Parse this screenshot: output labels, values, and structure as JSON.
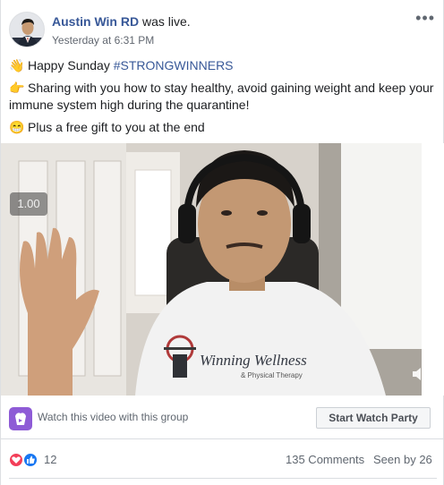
{
  "post": {
    "author": "Austin Win RD",
    "activity": "was live.",
    "timestamp": "Yesterday at 6:31 PM",
    "menu_icon": "more-dots-icon",
    "lines": [
      {
        "emoji": "👋",
        "text_before": "Happy Sunday ",
        "hashtag": "#STRONGWINNERS"
      },
      {
        "emoji": "👉",
        "text": "Sharing with you how to stay healthy, avoid gaining weight and keep your immune system high during the quarantine!"
      },
      {
        "emoji": "😁",
        "text": "Plus a free gift to you at the end"
      }
    ]
  },
  "video": {
    "speed_label": "1.00",
    "shirt_brand": "Winning Wellness",
    "shirt_sub": "& Physical Therapy",
    "mute_icon": "speaker-muted-icon"
  },
  "watch_party": {
    "icon": "watch-party-icon",
    "label": "Watch this video with this group",
    "button": "Start Watch Party"
  },
  "stats": {
    "reaction_icons": [
      "love-reaction-icon",
      "like-reaction-icon"
    ],
    "reactions_count": "12",
    "comments": "135 Comments",
    "seen": "Seen by 26"
  },
  "colors": {
    "link": "#385898",
    "secondary_text": "#606770",
    "watch_party_purple": "#8e5bd6",
    "like_blue": "#1877f2",
    "love_red": "#f33e58"
  }
}
